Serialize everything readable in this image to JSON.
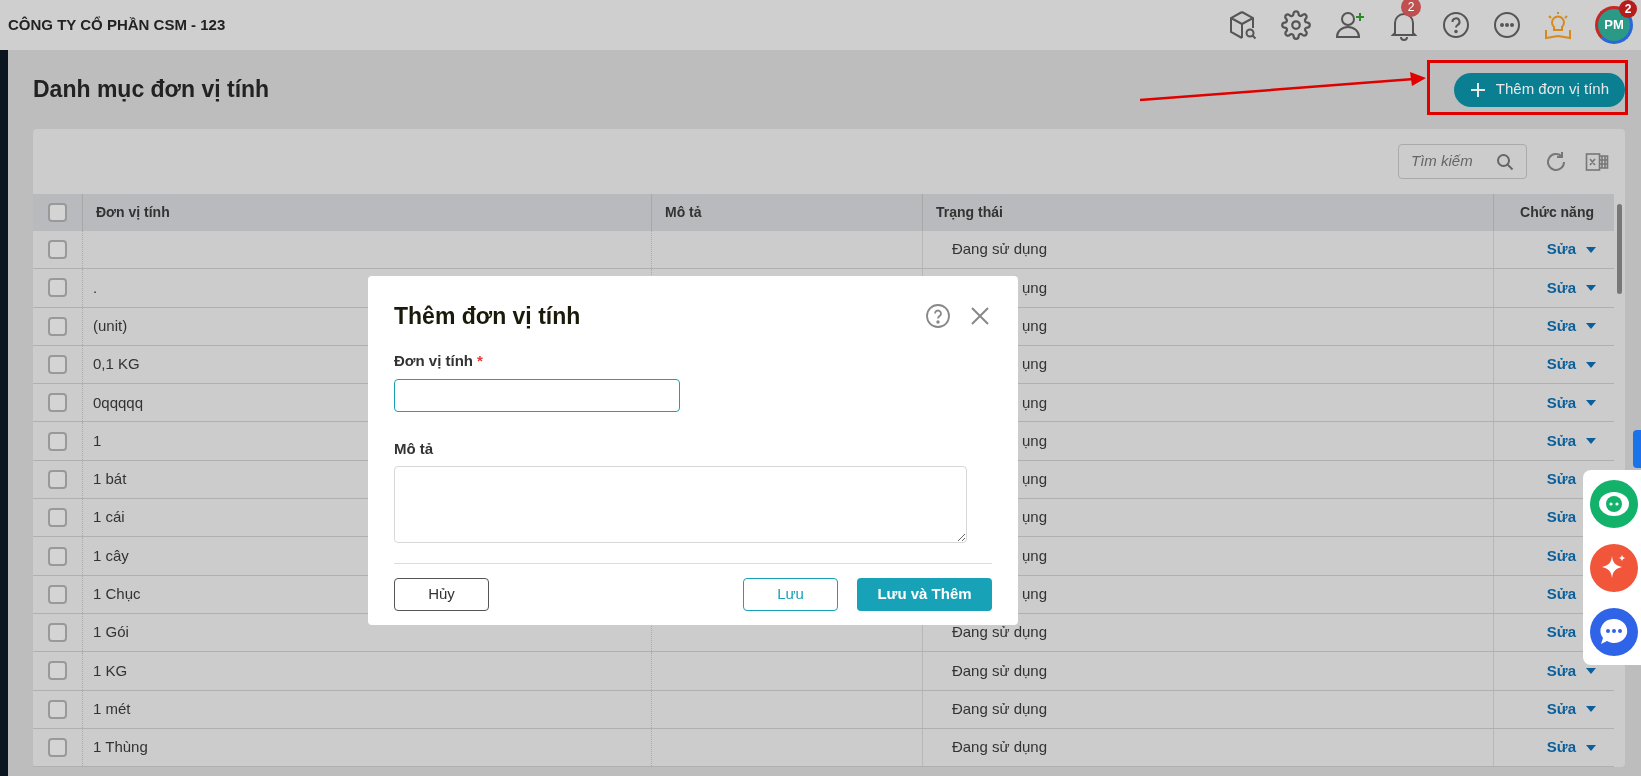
{
  "company": "CÔNG TY CỔ PHẦN CSM - 123",
  "notifications_badge": "2",
  "avatar": {
    "initials": "PM",
    "badge": "2"
  },
  "page_title": "Danh mục đơn vị tính",
  "add_button": "Thêm đơn vị tính",
  "search": {
    "placeholder": "Tìm kiếm"
  },
  "table": {
    "select_all_checked": false,
    "columns": [
      "Đơn vị tính",
      "Mô tả",
      "Trạng thái",
      "Chức năng"
    ],
    "rows": [
      {
        "checked": false,
        "status": "Đang sử dụng",
        "action": "Sửa"
      },
      {
        "checked": false,
        "name": ".",
        "status": "ụng",
        "action": "Sửa"
      },
      {
        "checked": false,
        "name": "(unit)",
        "status": "ụng",
        "action": "Sửa"
      },
      {
        "checked": false,
        "name": "0,1 KG",
        "status": "ụng",
        "action": "Sửa"
      },
      {
        "checked": false,
        "name": "0qqqqq",
        "status": "ụng",
        "action": "Sửa"
      },
      {
        "checked": false,
        "name": "1",
        "status": "ụng",
        "action": "Sửa"
      },
      {
        "checked": false,
        "name": "1 bát",
        "status": "ụng",
        "action": "Sửa",
        "caret_hidden": true
      },
      {
        "checked": false,
        "name": "1 cái",
        "status": "ụng",
        "action": "Sửa",
        "caret_hidden": true
      },
      {
        "checked": false,
        "name": "1 cây",
        "status": "ụng",
        "action": "Sửa",
        "caret_hidden": true
      },
      {
        "checked": false,
        "name": "1 Chục",
        "status": "ụng",
        "action": "Sửa",
        "caret_hidden": true
      },
      {
        "checked": false,
        "name": "1 Gói",
        "status": "Đang sử dụng",
        "action": "Sửa",
        "caret_hidden": true
      },
      {
        "checked": false,
        "name": "1 KG",
        "status": "Đang sử dụng",
        "action": "Sửa"
      },
      {
        "checked": false,
        "name": "1 mét",
        "status": "Đang sử dụng",
        "action": "Sửa"
      },
      {
        "checked": false,
        "name": "1 Thùng",
        "status": "Đang sử dụng",
        "action": "Sửa"
      }
    ]
  },
  "dialog": {
    "title": "Thêm đơn vị tính",
    "fields": [
      {
        "kind": "input",
        "label": "Đơn vị tính",
        "required_mark": "*",
        "focused": true
      },
      {
        "kind": "textarea",
        "label": "Mô tả",
        "focused": false
      }
    ],
    "buttons": [
      {
        "label": "Hủy",
        "kind": "secondary"
      },
      {
        "label": "Lưu",
        "kind": "outline"
      },
      {
        "label": "Lưu và Thêm",
        "kind": "primary"
      }
    ]
  }
}
